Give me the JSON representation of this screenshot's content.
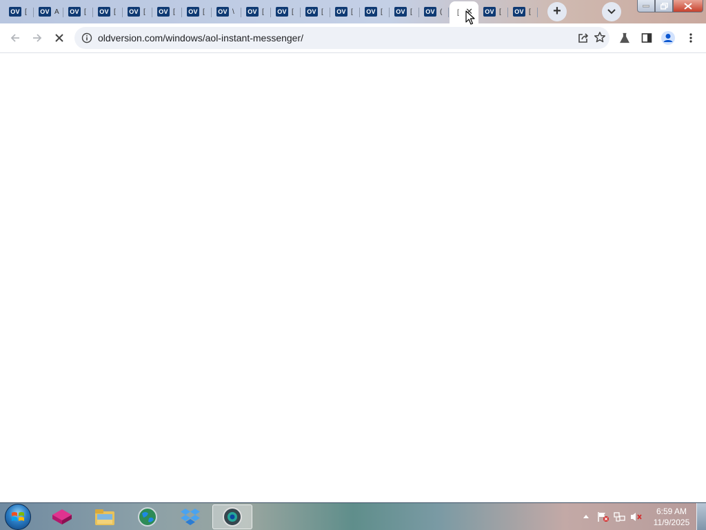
{
  "browser": {
    "tabs": [
      {
        "favicon": "OV",
        "title": "[",
        "active": false
      },
      {
        "favicon": "OV",
        "title": "A",
        "active": false
      },
      {
        "favicon": "OV",
        "title": "[",
        "active": false
      },
      {
        "favicon": "OV",
        "title": "[",
        "active": false
      },
      {
        "favicon": "OV",
        "title": "[",
        "active": false
      },
      {
        "favicon": "OV",
        "title": "[",
        "active": false
      },
      {
        "favicon": "OV",
        "title": "[",
        "active": false
      },
      {
        "favicon": "OV",
        "title": "\\",
        "active": false
      },
      {
        "favicon": "OV",
        "title": "[",
        "active": false
      },
      {
        "favicon": "OV",
        "title": "[",
        "active": false
      },
      {
        "favicon": "OV",
        "title": "[",
        "active": false
      },
      {
        "favicon": "OV",
        "title": "[",
        "active": false
      },
      {
        "favicon": "OV",
        "title": "[",
        "active": false
      },
      {
        "favicon": "OV",
        "title": "[",
        "active": false
      },
      {
        "favicon": "OV",
        "title": "(",
        "active": false
      },
      {
        "favicon": "",
        "title": "[",
        "active": true
      },
      {
        "favicon": "OV",
        "title": "[",
        "active": false
      },
      {
        "favicon": "OV",
        "title": "[",
        "active": false
      }
    ],
    "active_tab_close": "✕",
    "new_tab_label": "+",
    "url": "oldversion.com/windows/aol-instant-messenger/",
    "icons": {
      "back": "back-arrow-icon",
      "forward": "forward-arrow-icon",
      "stop": "stop-loading-icon",
      "info": "site-info-icon",
      "share": "share-icon",
      "bookmark": "star-icon",
      "extension": "flask-icon",
      "sidepanel": "side-panel-icon",
      "profile": "profile-icon",
      "menu": "kebab-menu-icon"
    }
  },
  "taskbar": {
    "clock_time": "6:59 AM",
    "clock_date": "11/9/2025",
    "apps": [
      "media-app-icon",
      "file-explorer-icon",
      "browser-globe-icon",
      "dropbox-icon",
      "active-browser-icon"
    ]
  }
}
